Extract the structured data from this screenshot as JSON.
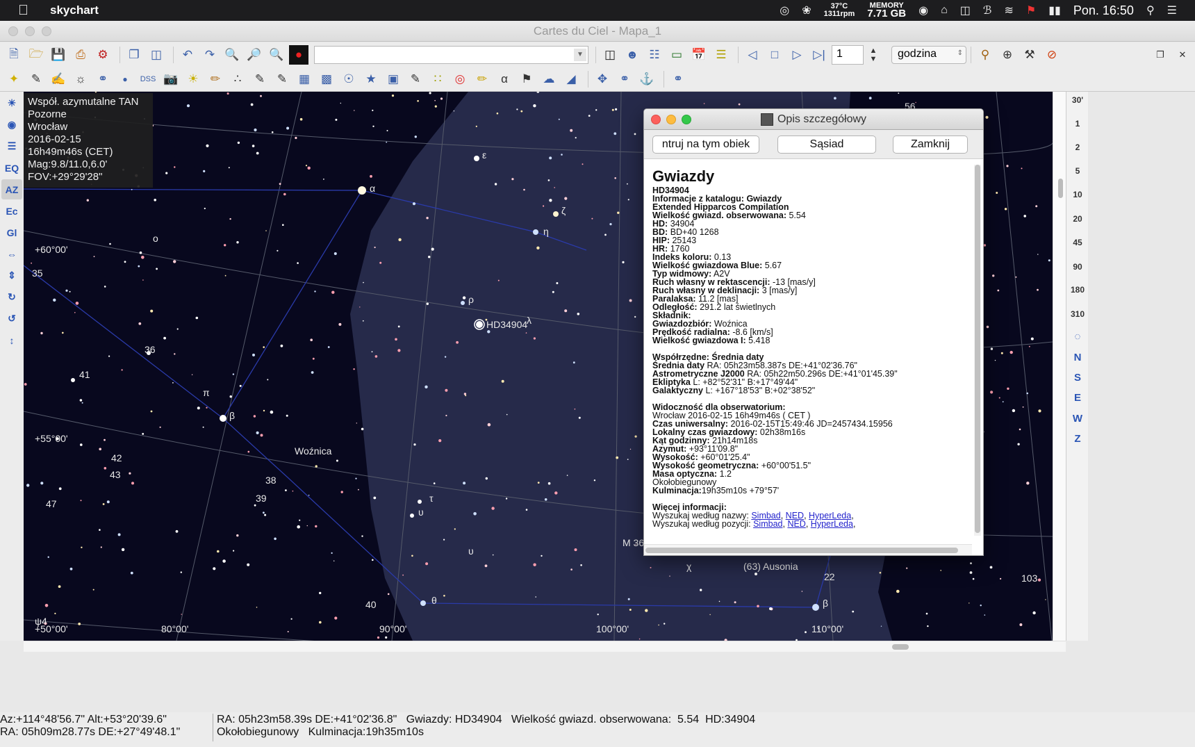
{
  "menubar": {
    "app_name": "skychart",
    "temp": "37°C",
    "rpm": "1311rpm",
    "memory_label": "MEMORY",
    "memory_value": "7.71 GB",
    "clock": "Pon. 16:50"
  },
  "window": {
    "title": "Cartes du Ciel - Mapa_1"
  },
  "toolbar": {
    "search_value": "",
    "step_value": "1",
    "unit_value": "godzina"
  },
  "toolbar2": {
    "dss_label": "DSS"
  },
  "left_tools": [
    "EQ",
    "AZ",
    "Ec",
    "Gl"
  ],
  "right_tools": {
    "fov": [
      "30'",
      "1",
      "2",
      "5",
      "10",
      "20",
      "45",
      "90",
      "180",
      "310"
    ],
    "directions": [
      "N",
      "S",
      "E",
      "W",
      "Z"
    ]
  },
  "info_overlay": {
    "projection": "Współ. azymutalne TAN",
    "mode": "Pozorne",
    "location": "Wrocław",
    "date": "2016-02-15",
    "time": "16h49m46s (CET)",
    "mag": "Mag:9.8/11.0,6.0'",
    "fov": "FOV:+29°29'28\""
  },
  "sky_labels": {
    "constellation": "Woźnica",
    "selected_star": "HD34904",
    "grid_dec": [
      "+60°00'",
      "+55°00'",
      "+50°00'"
    ],
    "grid_ra": [
      "80°00'",
      "90°00'",
      "100°00'",
      "110°00'"
    ],
    "greek": [
      "α",
      "ε",
      "ζ",
      "η",
      "ρ",
      "λ",
      "β",
      "π",
      "ο",
      "τ",
      "υ",
      "υ",
      "θ",
      "χ",
      "β",
      "ψ4"
    ],
    "numbers": [
      "35",
      "36",
      "41",
      "42",
      "43",
      "47",
      "38",
      "39",
      "40",
      "56",
      "22",
      "103"
    ],
    "objects": [
      "M 36",
      "(63) Ausonia"
    ]
  },
  "status": {
    "line1_left": "Az:+114°48'56.7\" Alt:+53°20'39.6\"",
    "line2_left": "RA: 05h09m28.77s DE:+27°49'48.1\"",
    "line1_right": "RA: 05h23m58.39s DE:+41°02'36.8\"   Gwiazdy: HD34904   Wielkość gwiazd. obserwowana:  5.54  HD:34904",
    "line2_right": "Okołobiegunowy   Kulminacja:19h35m10s"
  },
  "dialog": {
    "title": "Opis szczegółowy",
    "btn_center": "ntruj na tym obiek",
    "btn_neighbor": "Sąsiad",
    "btn_close": "Zamknij",
    "heading": "Gwiazdy",
    "name": "HD34904",
    "catalog_label": "Informacje z katalogu: Gwiazdy",
    "catalog_name": "Extended Hipparcos Compilation",
    "fields": [
      {
        "k": "Wielkość gwiazd. obserwowana:",
        "v": " 5.54"
      },
      {
        "k": "HD:",
        "v": " 34904"
      },
      {
        "k": "BD:",
        "v": " BD+40 1268"
      },
      {
        "k": "HIP:",
        "v": " 25143"
      },
      {
        "k": "HR:",
        "v": " 1760"
      },
      {
        "k": "Indeks koloru:",
        "v": " 0.13"
      },
      {
        "k": "Wielkość gwiazdowa Blue:",
        "v": " 5.67"
      },
      {
        "k": "Typ widmowy:",
        "v": " A2V"
      },
      {
        "k": "Ruch własny w rektascencji:",
        "v": " -13 [mas/y]"
      },
      {
        "k": "Ruch własny w deklinacji:",
        "v": " 3 [mas/y]"
      },
      {
        "k": "Paralaksa:",
        "v": " 11.2 [mas]"
      },
      {
        "k": "Odległość:",
        "v": " 291.2 lat świetlnych"
      },
      {
        "k": "Składnik:",
        "v": ""
      },
      {
        "k": "Gwiazdozbiór:",
        "v": " Woźnica"
      },
      {
        "k": "Prędkość radialna:",
        "v": " -8.6 [km/s]"
      },
      {
        "k": "Wielkość gwiazdowa I:",
        "v": " 5.418"
      }
    ],
    "coords_heading": "Współrzędne: Średnia daty",
    "coords": [
      {
        "k": "Średnia daty",
        "v": " RA: 05h23m58.387s DE:+41°02'36.76\""
      },
      {
        "k": "Astrometryczne J2000",
        "v": " RA: 05h22m50.296s DE:+41°01'45.39\""
      },
      {
        "k": "Ekliptyka",
        "v": "  L: +82°52'31\" B:+17°49'44\""
      },
      {
        "k": "Galaktyczny",
        "v": "  L: +167°18'53\" B:+02°38'52\""
      }
    ],
    "vis_heading": "Widoczność dla obserwatorium:",
    "vis_location": "Wrocław 2016-02-15 16h49m46s ( CET )",
    "vis": [
      {
        "k": "Czas uniwersalny:",
        "v": " 2016-02-15T15:49:46 JD=2457434.15956"
      },
      {
        "k": "Lokalny czas gwiazdowy:",
        "v": " 02h38m16s"
      },
      {
        "k": "Kąt godzinny:",
        "v": " 21h14m18s"
      },
      {
        "k": "Azymut:",
        "v": " +93°11'09.8\""
      },
      {
        "k": "Wysokość:",
        "v": " +60°01'25.4\""
      },
      {
        "k": "Wysokość geometryczna:",
        "v": " +60°00'51.5\""
      },
      {
        "k": "Masa optyczna:",
        "v": " 1.2"
      }
    ],
    "circumpolar": "Okołobiegunowy",
    "culmination_label": "Kulminacja:",
    "culmination_value": "19h35m10s +79°57'",
    "more_heading": "Więcej informacji:",
    "search_name_label": "Wyszukaj według nazwy:",
    "search_pos_label": "Wyszukaj według pozycji:",
    "link_simbad": "Simbad",
    "link_ned": "NED",
    "link_hyperleda": "HyperLeda"
  }
}
